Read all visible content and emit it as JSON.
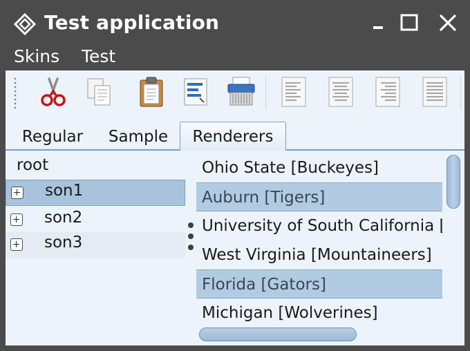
{
  "window": {
    "title": "Test application",
    "app_icon": "diamond-app-icon",
    "controls": [
      "minimize-icon",
      "maximize-icon",
      "close-icon"
    ]
  },
  "menu": {
    "items": [
      {
        "label": "Skins"
      },
      {
        "label": "Test"
      }
    ]
  },
  "toolbar": {
    "buttons": [
      {
        "icon": "cut-icon"
      },
      {
        "icon": "copy-icon"
      },
      {
        "icon": "paste-icon"
      },
      {
        "icon": "format-icon"
      },
      {
        "icon": "shredder-icon"
      },
      {
        "icon": "align-left-icon"
      },
      {
        "icon": "align-center-icon"
      },
      {
        "icon": "align-right-icon"
      },
      {
        "icon": "align-justify-icon"
      }
    ]
  },
  "tabs": {
    "items": [
      {
        "label": "Regular",
        "selected": false
      },
      {
        "label": "Sample",
        "selected": false
      },
      {
        "label": "Renderers",
        "selected": true
      }
    ]
  },
  "tree": {
    "root": "root",
    "children": [
      {
        "label": "son1",
        "selected": true
      },
      {
        "label": "son2",
        "selected": false
      },
      {
        "label": "son3",
        "selected": false
      }
    ]
  },
  "list": {
    "items": [
      {
        "label": "Ohio State [Buckeyes]",
        "selected": false
      },
      {
        "label": "Auburn [Tigers]",
        "selected": true
      },
      {
        "label": "University of South California [Trojans]",
        "selected": false
      },
      {
        "label": "West Virginia [Mountaineers]",
        "selected": false
      },
      {
        "label": "Florida [Gators]",
        "selected": true
      },
      {
        "label": "Michigan [Wolverines]",
        "selected": false
      }
    ]
  },
  "colors": {
    "titlebar": "#4b4b4b",
    "content_bg": "#edf3fa",
    "selection": "#b1cbe3",
    "accent_border": "#7c9cbf"
  }
}
